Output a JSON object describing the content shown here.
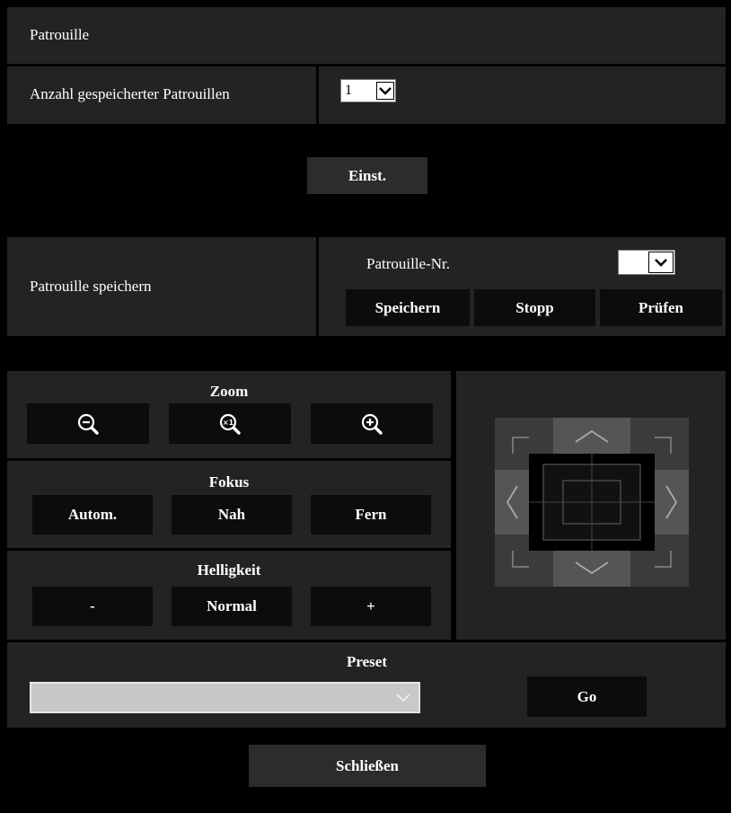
{
  "title": "Patrouille",
  "count_row": {
    "label": "Anzahl gespeicherter Patrouillen",
    "value": "1"
  },
  "set_button": "Einst.",
  "save_row": {
    "label": "Patrouille speichern",
    "number_label": "Patrouille-Nr.",
    "number_value": "",
    "buttons": {
      "save": "Speichern",
      "stop": "Stopp",
      "test": "Prüfen"
    }
  },
  "zoom": {
    "title": "Zoom",
    "out_icon": "zoom-out-icon",
    "reset_icon": "zoom-x1-icon",
    "in_icon": "zoom-in-icon"
  },
  "focus": {
    "title": "Fokus",
    "auto": "Autom.",
    "near": "Nah",
    "far": "Fern"
  },
  "brightness": {
    "title": "Helligkeit",
    "minus": "-",
    "normal": "Normal",
    "plus": "+"
  },
  "preset": {
    "title": "Preset",
    "value": "",
    "go": "Go"
  },
  "close_button": "Schließen"
}
